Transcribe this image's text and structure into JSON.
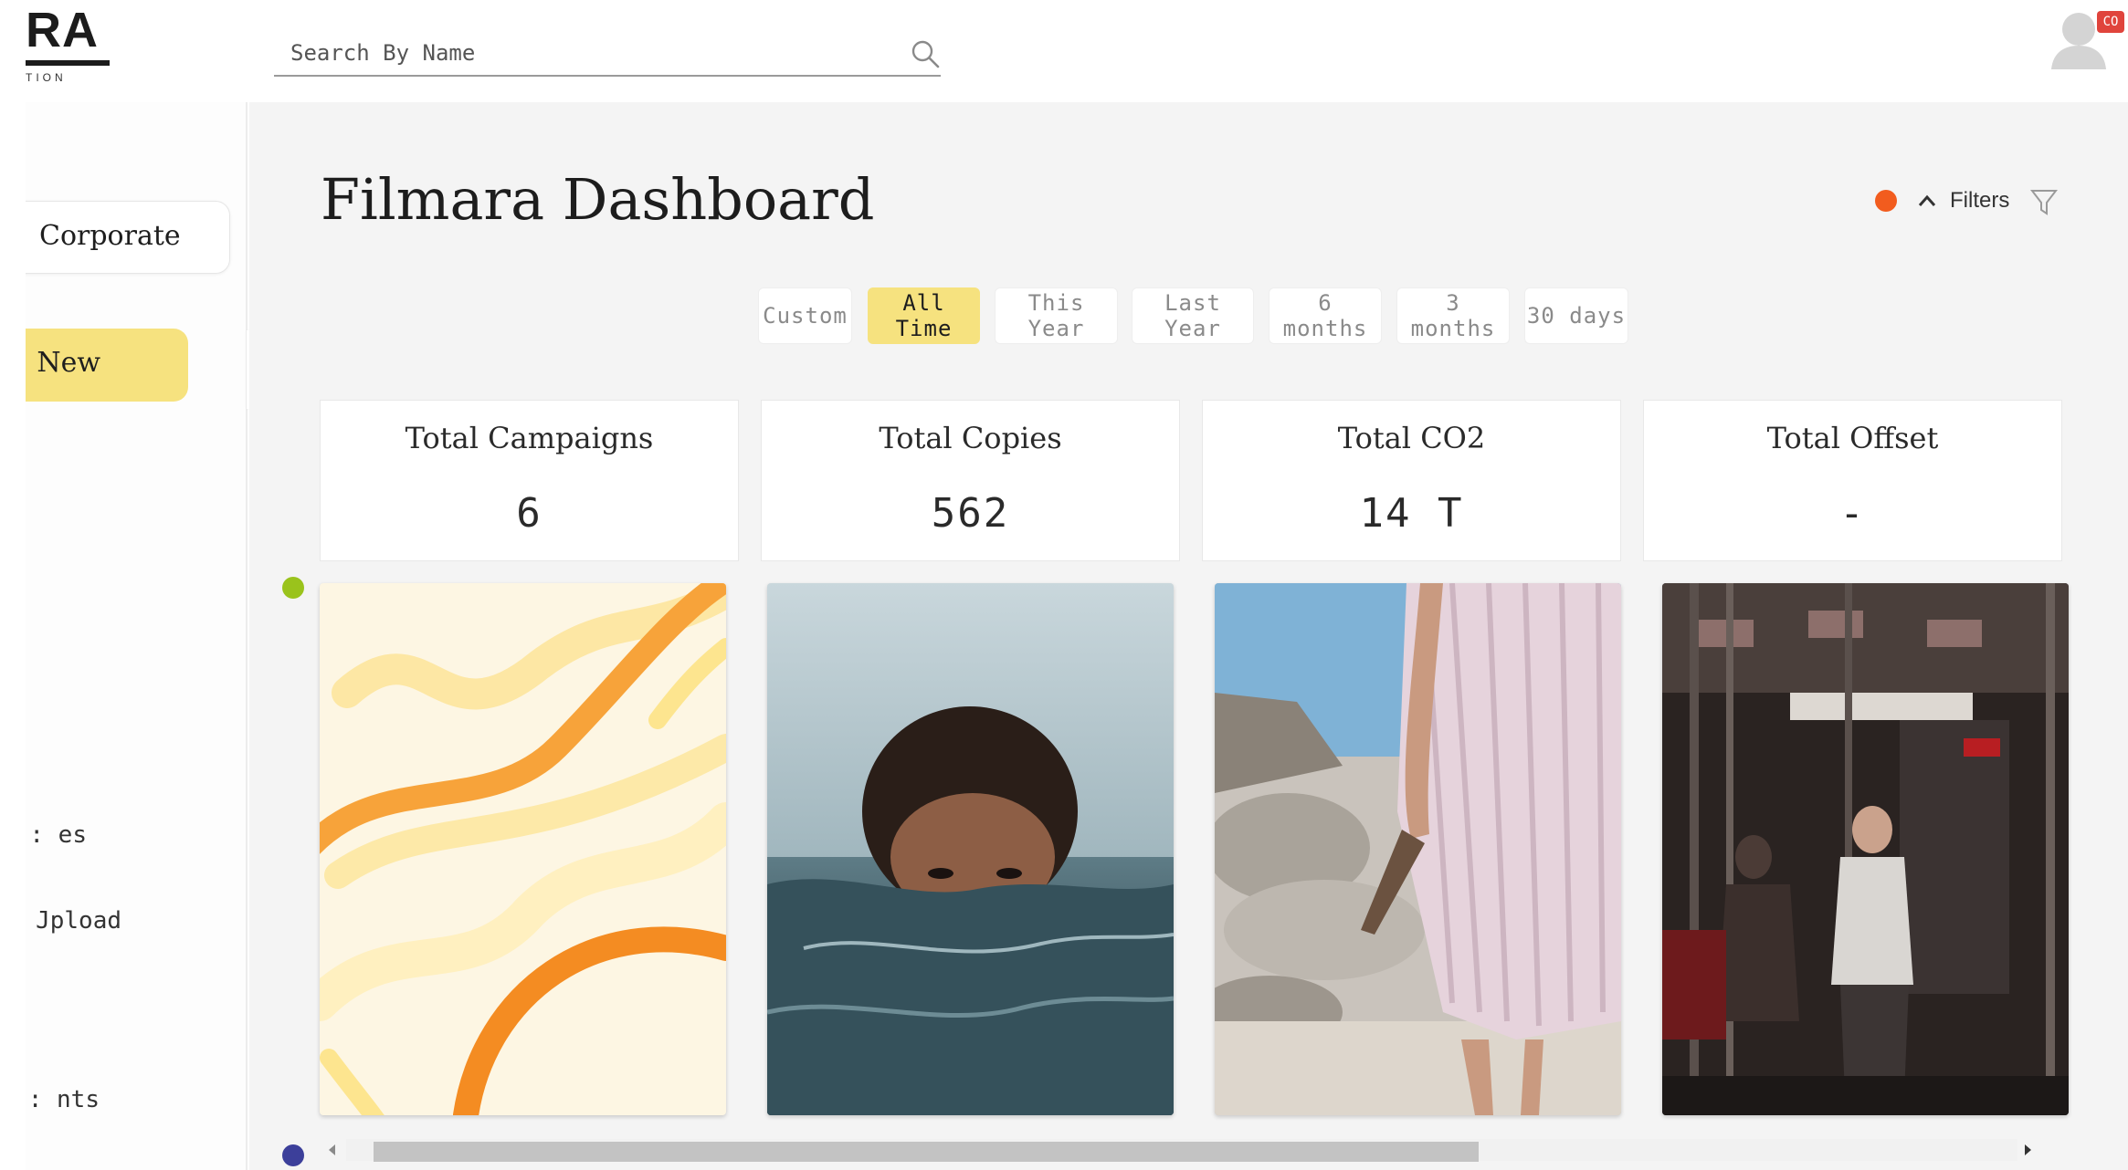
{
  "header": {
    "logo_text": "RA",
    "logo_subtext": "TION",
    "search_placeholder": "Search By Name",
    "avatar_badge": "CO"
  },
  "sidebar": {
    "account_label": "Corporate",
    "new_button_label": ": New",
    "links": [
      ": es",
      "Jpload",
      ": nts"
    ]
  },
  "main": {
    "title": "Filmara Dashboard",
    "filters_label": "Filters",
    "date_ranges": [
      {
        "label": "Custom",
        "active": false
      },
      {
        "label": "All Time",
        "active": true
      },
      {
        "label": "This Year",
        "active": false
      },
      {
        "label": "Last Year",
        "active": false
      },
      {
        "label": "6 months",
        "active": false
      },
      {
        "label": "3 months",
        "active": false
      },
      {
        "label": "30 days",
        "active": false
      }
    ],
    "stats": [
      {
        "label": "Total Campaigns",
        "value": "6"
      },
      {
        "label": "Total Copies",
        "value": "562"
      },
      {
        "label": "Total CO2",
        "value": "14 T"
      },
      {
        "label": "Total Offset",
        "value": "-"
      }
    ],
    "media": [
      {
        "name": "abstract-brushstrokes-image"
      },
      {
        "name": "face-in-water-image"
      },
      {
        "name": "pleated-skirt-beach-image"
      },
      {
        "name": "subway-train-interior-image"
      }
    ]
  },
  "colors": {
    "accent_yellow": "#f6e27f",
    "status_orange": "#f25c1e",
    "status_green": "#9ac31c",
    "status_blue": "#3c3f9a",
    "badge_red": "#e0443c"
  }
}
